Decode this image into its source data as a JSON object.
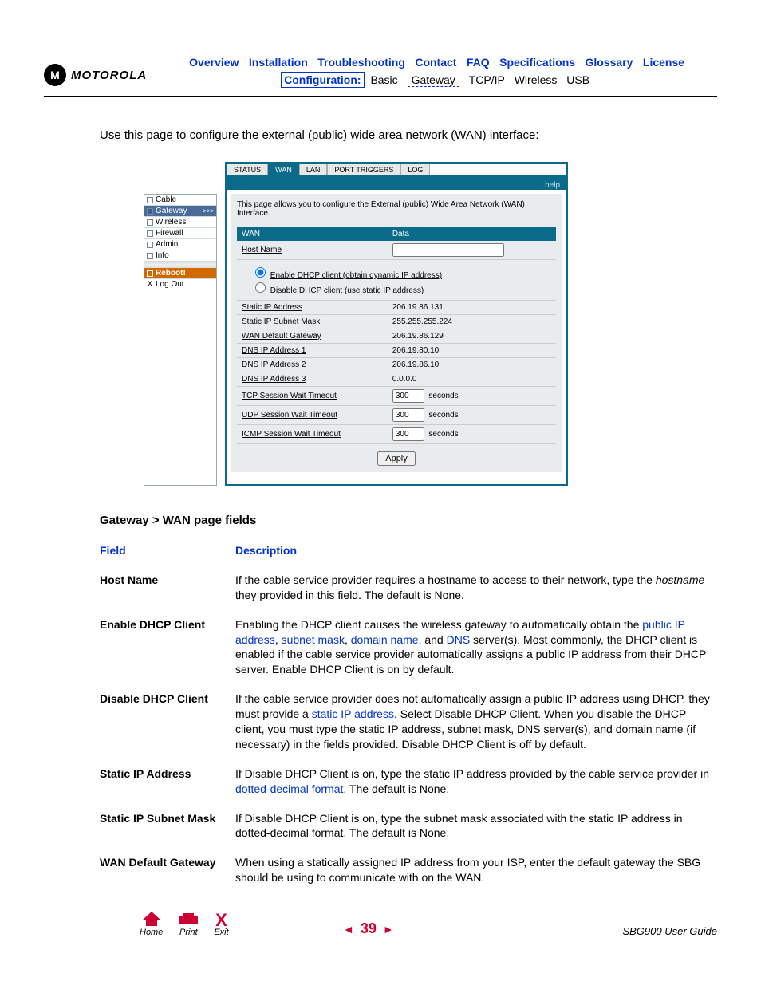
{
  "brand": "MOTOROLA",
  "navTop": [
    "Overview",
    "Installation",
    "Troubleshooting",
    "Contact",
    "FAQ",
    "Specifications",
    "Glossary",
    "License"
  ],
  "navSub": {
    "label": "Configuration:",
    "items": [
      "Basic",
      "Gateway",
      "TCP/IP",
      "Wireless",
      "USB"
    ],
    "active": "Gateway"
  },
  "intro": "Use this page to configure the external (public) wide area network (WAN) interface:",
  "sideNav": {
    "items": [
      "Cable",
      "Gateway",
      "Wireless",
      "Firewall",
      "Admin",
      "Info"
    ],
    "selected": "Gateway",
    "reboot": "Reboot!",
    "logout": "Log Out"
  },
  "panel": {
    "tabs": [
      "STATUS",
      "WAN",
      "LAN",
      "PORT TRIGGERS",
      "LOG"
    ],
    "activeTab": "WAN",
    "help": "help",
    "desc": "This page allows you to configure the External (public) Wide Area Network (WAN) Interface.",
    "headers": {
      "wan": "WAN",
      "data": "Data"
    },
    "hostNameLabel": "Host Name",
    "hostNameValue": "",
    "radioEnable": "Enable DHCP client (obtain dynamic IP address)",
    "radioDisable": "Disable DHCP client (use static IP address)",
    "rows": [
      {
        "label": "Static IP Address",
        "value": "206.19.86.131"
      },
      {
        "label": "Static IP Subnet Mask",
        "value": "255.255.255.224"
      },
      {
        "label": "WAN Default Gateway",
        "value": "206.19.86.129"
      },
      {
        "label": "DNS IP Address 1",
        "value": "206.19.80.10"
      },
      {
        "label": "DNS IP Address 2",
        "value": "206.19.86.10"
      },
      {
        "label": "DNS IP Address 3",
        "value": "0.0.0.0"
      }
    ],
    "timeouts": [
      {
        "label": "TCP Session Wait Timeout",
        "value": "300",
        "unit": "seconds"
      },
      {
        "label": "UDP Session Wait Timeout",
        "value": "300",
        "unit": "seconds"
      },
      {
        "label": "ICMP Session Wait Timeout",
        "value": "300",
        "unit": "seconds"
      }
    ],
    "apply": "Apply"
  },
  "sectionTitle": "Gateway > WAN page fields",
  "fieldHead": {
    "field": "Field",
    "desc": "Description"
  },
  "fields": [
    {
      "name": "Host Name",
      "html": "If the cable service provider requires a hostname to access to their network, type the <i>hostname</i> they provided in this field. The default is None."
    },
    {
      "name": "Enable DHCP Client",
      "html": "Enabling the DHCP client causes the wireless gateway to automatically obtain the <a class='glink'>public IP address</a>, <a class='glink'>subnet mask</a>, <a class='glink'>domain name</a>, and <a class='glink'>DNS</a> server(s). Most commonly, the DHCP client is enabled if the cable service provider automatically assigns a public IP address from their DHCP server. Enable DHCP Client is on by default."
    },
    {
      "name": "Disable DHCP Client",
      "html": "If the cable service provider does not automatically assign a public IP address using DHCP, they must provide a <a class='glink'>static IP address</a>. Select Disable DHCP Client. When you disable the DHCP client, you must type the static IP address, subnet mask, DNS server(s), and domain name (if necessary) in the fields provided. Disable DHCP Client is off by default."
    },
    {
      "name": "Static IP Address",
      "html": "If Disable DHCP Client is on, type the static IP address provided by the cable service provider in <a class='glink'>dotted-decimal format</a>. The default is None."
    },
    {
      "name": "Static IP Subnet Mask",
      "html": "If Disable DHCP Client is on, type the subnet mask associated with the static IP address in dotted-decimal format. The default is None."
    },
    {
      "name": "WAN Default Gateway",
      "html": "When using a statically assigned IP address from your ISP, enter the default gateway the SBG should be using to communicate with on the WAN."
    }
  ],
  "footer": {
    "home": "Home",
    "print": "Print",
    "exit": "Exit",
    "page": "39",
    "guide": "SBG900 User Guide"
  }
}
